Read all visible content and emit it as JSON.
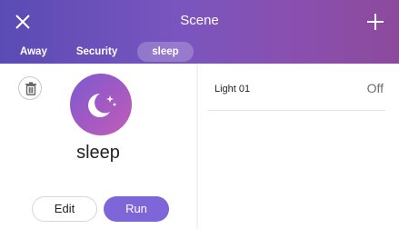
{
  "header": {
    "title": "Scene",
    "close_icon": "close-icon",
    "add_icon": "plus-icon",
    "tabs": [
      {
        "label": "Away",
        "active": false
      },
      {
        "label": "Security",
        "active": false
      },
      {
        "label": "sleep",
        "active": true
      }
    ]
  },
  "scene": {
    "name": "sleep",
    "icon": "moon-stars-icon",
    "delete_icon": "trash-icon",
    "edit_label": "Edit",
    "run_label": "Run"
  },
  "devices": [
    {
      "name": "Light 01",
      "status": "Off"
    }
  ],
  "colors": {
    "accent": "#7f66d8",
    "header_start": "#5a4bb4",
    "header_end": "#8c4a9d"
  }
}
